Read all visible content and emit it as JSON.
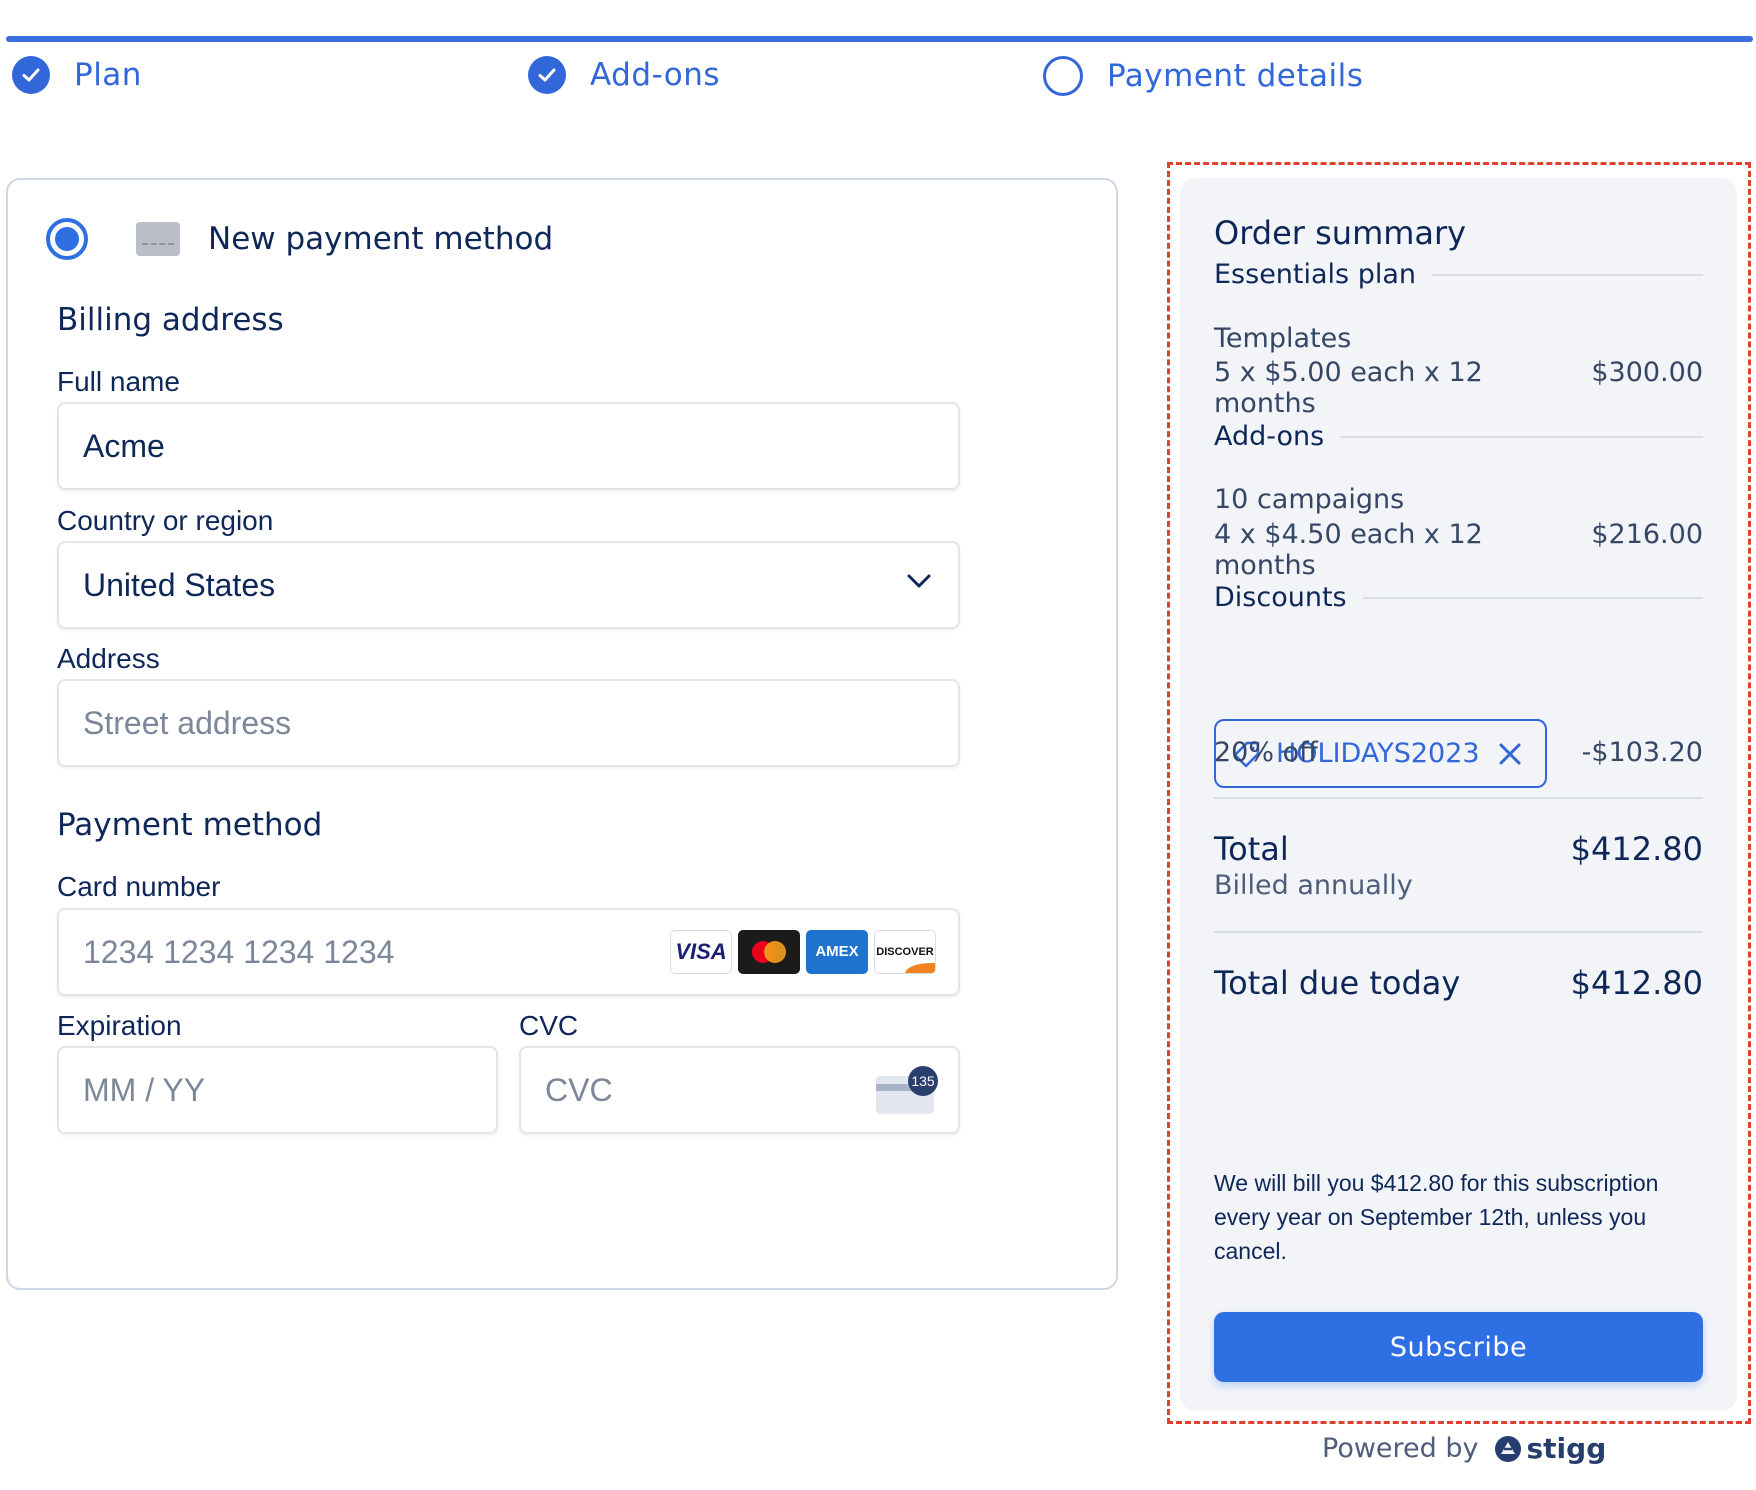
{
  "steps": [
    {
      "label": "Plan",
      "status": "complete"
    },
    {
      "label": "Add-ons",
      "status": "complete"
    },
    {
      "label": "Payment details",
      "status": "current"
    }
  ],
  "payment_form": {
    "method_option": "New payment method",
    "billing_title": "Billing address",
    "full_name_label": "Full name",
    "full_name_value": "Acme",
    "country_label": "Country or region",
    "country_value": "United States",
    "address_label": "Address",
    "address_placeholder": "Street address",
    "payment_title": "Payment method",
    "card_label": "Card number",
    "card_placeholder": "1234 1234 1234 1234",
    "card_brands": [
      "VISA",
      "mastercard",
      "AMEX",
      "DISCOVER"
    ],
    "expiration_label": "Expiration",
    "expiration_placeholder": "MM / YY",
    "cvc_label": "CVC",
    "cvc_placeholder": "CVC",
    "cvc_badge": "135"
  },
  "summary": {
    "title": "Order summary",
    "plan_header": "Essentials plan",
    "plan_item_name": "Templates",
    "plan_item_detail": "5 x $5.00 each x 12 months",
    "plan_item_price": "$300.00",
    "addons_header": "Add-ons",
    "addon_item_name": "10 campaigns",
    "addon_item_detail": "4 x $4.50 each x 12 months",
    "addon_item_price": "$216.00",
    "discounts_header": "Discounts",
    "coupon_code": "HOLIDAYS2023",
    "discount_label": "20% off",
    "discount_amount": "-$103.20",
    "total_label": "Total",
    "total_amount": "$412.80",
    "billing_cycle": "Billed annually",
    "due_label": "Total due today",
    "due_amount": "$412.80",
    "note": "We will bill you $412.80 for this subscription every year on September 12th, unless you cancel.",
    "subscribe_label": "Subscribe"
  },
  "footer": {
    "powered_by": "Powered by",
    "brand": "stigg"
  },
  "colors": {
    "accent": "#3267d9",
    "text": "#0e2759",
    "highlight_outline": "#e0412e",
    "summary_bg": "#f2f4f8"
  }
}
